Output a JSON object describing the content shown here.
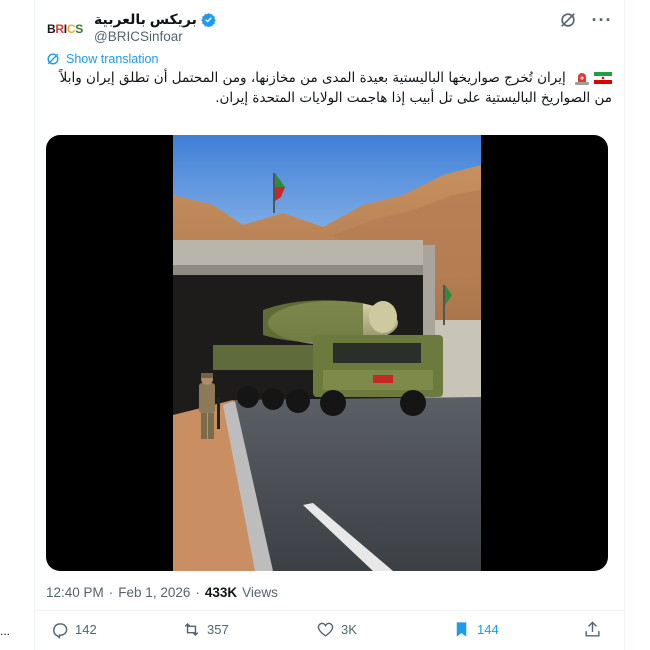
{
  "account": {
    "avatar_text": [
      "B",
      "R",
      "I",
      "C",
      "S"
    ],
    "display_name": "بريكس بالعربية",
    "handle": "@BRICSinfoar"
  },
  "header": {
    "grok_icon": "grok-slash-circle-icon",
    "more_icon": "more-dots-icon",
    "more_label": "···"
  },
  "translate": {
    "label": "Show translation"
  },
  "tweet": {
    "text": "إيران تُخرج صواريخها الباليستية بعيدة المدى من مخازنها، ومن المحتمل أن تطلق إيران وابلاً من الصواريخ الباليستية على تل أبيب إذا هاجمت الولايات المتحدة إيران.",
    "leading_icons": [
      "iran-flag-icon",
      "siren-icon"
    ]
  },
  "meta": {
    "time": "12:40 PM",
    "dot": "·",
    "date": "Feb 1, 2026",
    "views_count": "433K",
    "views_label": "Views"
  },
  "actions": {
    "reply_count": "142",
    "repost_count": "357",
    "like_count": "3K",
    "bookmark_count": "144"
  },
  "side": {
    "dots": "..."
  },
  "colors": {
    "accent": "#1d9bf0",
    "secondary_text": "#536471",
    "primary_text": "#0f1419"
  }
}
